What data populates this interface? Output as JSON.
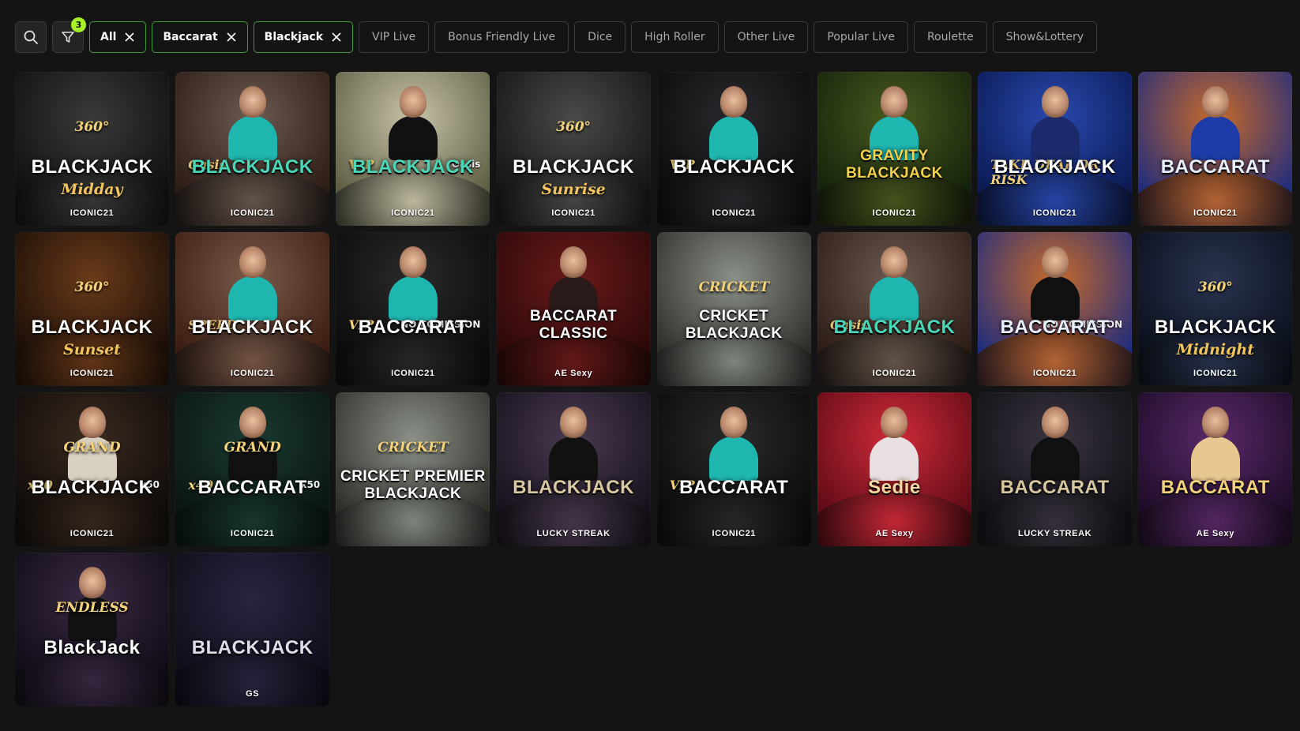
{
  "filters": {
    "badge_count": "3",
    "chips": [
      {
        "label": "All",
        "active": true
      },
      {
        "label": "Baccarat",
        "active": true
      },
      {
        "label": "Blackjack",
        "active": true
      },
      {
        "label": "VIP Live",
        "active": false
      },
      {
        "label": "Bonus Friendly Live",
        "active": false
      },
      {
        "label": "Dice",
        "active": false
      },
      {
        "label": "High Roller",
        "active": false
      },
      {
        "label": "Other Live",
        "active": false
      },
      {
        "label": "Popular Live",
        "active": false
      },
      {
        "label": "Roulette",
        "active": false
      },
      {
        "label": "Show&Lottery",
        "active": false
      }
    ]
  },
  "games": [
    {
      "top": "360°",
      "main": "BLACKJACK",
      "sub": "Midday",
      "provider": "ICONIC21",
      "bg": [
        "#3a3a3a",
        "#0e0e0e"
      ],
      "main_color": "#ffffff",
      "person": false
    },
    {
      "tag_left": "Oasis",
      "main": "BLACKJACK",
      "provider": "ICONIC21",
      "bg": [
        "#6a5a50",
        "#2a1a14"
      ],
      "main_color": "#4ad7b8",
      "person": true,
      "outfit": "#1fb6b0"
    },
    {
      "tag_left": "VIP",
      "tag_right": "Oasis",
      "main": "BLACKJACK",
      "provider": "ICONIC21",
      "bg": [
        "#c8c4a8",
        "#5a5a40"
      ],
      "main_color": "#4ad7b8",
      "person": true,
      "outfit": "#111111"
    },
    {
      "top": "360°",
      "main": "BLACKJACK",
      "sub": "Sunrise",
      "provider": "ICONIC21",
      "bg": [
        "#4a4a48",
        "#121212"
      ],
      "main_color": "#ffffff",
      "person": false
    },
    {
      "tag_left": "VIP",
      "main": "BLACKJACK",
      "provider": "ICONIC21",
      "bg": [
        "#2a2a2e",
        "#0a0a0c"
      ],
      "main_color": "#ffffff",
      "person": true,
      "outfit": "#1fb6b0"
    },
    {
      "main": "GRAVITY BLACKJACK",
      "provider": "ICONIC21",
      "bg": [
        "#4a5a20",
        "#12200a"
      ],
      "main_color": "#f4d24a",
      "person": true,
      "outfit": "#1fb6b0"
    },
    {
      "tag_left": "TAKE DEAL OR RISK",
      "main": "BLACKJACK",
      "provider": "ICONIC21",
      "bg": [
        "#2a4ab0",
        "#0a1850"
      ],
      "main_color": "#ffffff",
      "person": true,
      "outfit": "#1a2a6a"
    },
    {
      "main": "BACCARAT",
      "provider": "ICONIC21",
      "bg": [
        "#c86a2a",
        "#1a2a80"
      ],
      "main_color": "#e8f0ff",
      "person": true,
      "outfit": "#1e3ca8"
    },
    {
      "top": "360°",
      "main": "BLACKJACK",
      "sub": "Sunset",
      "provider": "ICONIC21",
      "bg": [
        "#6a3a1a",
        "#160c06"
      ],
      "main_color": "#ffffff",
      "person": false
    },
    {
      "tag_left": "SPEED",
      "main": "BLACKJACK",
      "provider": "ICONIC21",
      "bg": [
        "#7a5a4a",
        "#3a1a10"
      ],
      "main_color": "#ffffff",
      "person": true,
      "outfit": "#1fb6b0"
    },
    {
      "tag_left": "VIP",
      "tag_right": "NO COMISSION",
      "main": "BACCARAT",
      "provider": "ICONIC21",
      "bg": [
        "#2a2a2a",
        "#0a0a0a"
      ],
      "main_color": "#ffffff",
      "person": true,
      "outfit": "#1fb6b0"
    },
    {
      "main": "BACCARAT CLASSIC",
      "provider": "AE Sexy",
      "bg": [
        "#6a1a1a",
        "#2a0808"
      ],
      "main_color": "#ffffff",
      "person": true,
      "outfit": "#2a1a1a"
    },
    {
      "top": "CRICKET",
      "main": "CRICKET BLACKJACK",
      "provider": "",
      "bg": [
        "#8a9088",
        "#2a2a24"
      ],
      "main_color": "#ffffff",
      "person": false
    },
    {
      "tag_left": "Oasis",
      "main": "BLACKJACK",
      "provider": "ICONIC21",
      "bg": [
        "#6a5a50",
        "#2a1a14"
      ],
      "main_color": "#4ad7b8",
      "person": true,
      "outfit": "#1fb6b0"
    },
    {
      "tag_right": "NO COMISSION",
      "main": "BACCARAT",
      "provider": "ICONIC21",
      "bg": [
        "#c86a2a",
        "#1a2a80"
      ],
      "main_color": "#e8f0ff",
      "person": true,
      "outfit": "#111111"
    },
    {
      "top": "360°",
      "main": "BLACKJACK",
      "sub": "Midnight",
      "provider": "ICONIC21",
      "bg": [
        "#2a3450",
        "#0a0e1a"
      ],
      "main_color": "#ffffff",
      "person": false
    },
    {
      "top": "GRAND",
      "main": "BLACKJACK",
      "tag_left": "x40",
      "tag_right": "x50",
      "provider": "ICONIC21",
      "bg": [
        "#3a2a20",
        "#0e0a08"
      ],
      "main_color": "#ffffff",
      "person": true,
      "outfit": "#d8d0c0"
    },
    {
      "top": "GRAND",
      "main": "BACCARAT",
      "tag_left": "x40",
      "tag_right": "x50",
      "provider": "ICONIC21",
      "bg": [
        "#1a3a30",
        "#0a1410"
      ],
      "main_color": "#ffffff",
      "person": true,
      "outfit": "#111111"
    },
    {
      "top": "CRICKET",
      "main": "CRICKET PREMIER BLACKJACK",
      "provider": "",
      "bg": [
        "#8a9088",
        "#2a2a24"
      ],
      "main_color": "#ffffff",
      "person": false
    },
    {
      "main": "BLACKJACK",
      "provider": "LUCKY STREAK",
      "bg": [
        "#4a3a50",
        "#14101a"
      ],
      "main_color": "#d8c8a0",
      "person": true,
      "outfit": "#111111"
    },
    {
      "tag_left": "VIP",
      "main": "BACCARAT",
      "provider": "ICONIC21",
      "bg": [
        "#2a2a2a",
        "#0a0a0a"
      ],
      "main_color": "#ffffff",
      "person": true,
      "outfit": "#1fb6b0"
    },
    {
      "main": "Sedie",
      "provider": "AE Sexy",
      "bg": [
        "#d02a3a",
        "#5a0a14"
      ],
      "main_color": "#f4d8a0",
      "person": true,
      "outfit": "#e8e0e0"
    },
    {
      "main": "BACCARAT",
      "provider": "LUCKY STREAK",
      "bg": [
        "#3a3440",
        "#100e14"
      ],
      "main_color": "#d8c8a0",
      "person": true,
      "outfit": "#111111"
    },
    {
      "main": "BACCARAT",
      "provider": "AE Sexy",
      "bg": [
        "#5a2a6a",
        "#1a0a24"
      ],
      "main_color": "#f4d27a",
      "person": true,
      "outfit": "#e8c890"
    },
    {
      "main": "BlackJack",
      "top": "ENDLESS",
      "provider": "",
      "bg": [
        "#3a2a44",
        "#0e0a14"
      ],
      "main_color": "#ffffff",
      "person": true,
      "outfit": "#111111"
    },
    {
      "main": "BLACKJACK",
      "provider": "GS",
      "bg": [
        "#2a2440",
        "#0e0c18"
      ],
      "main_color": "#e0dcea",
      "person": false
    }
  ]
}
